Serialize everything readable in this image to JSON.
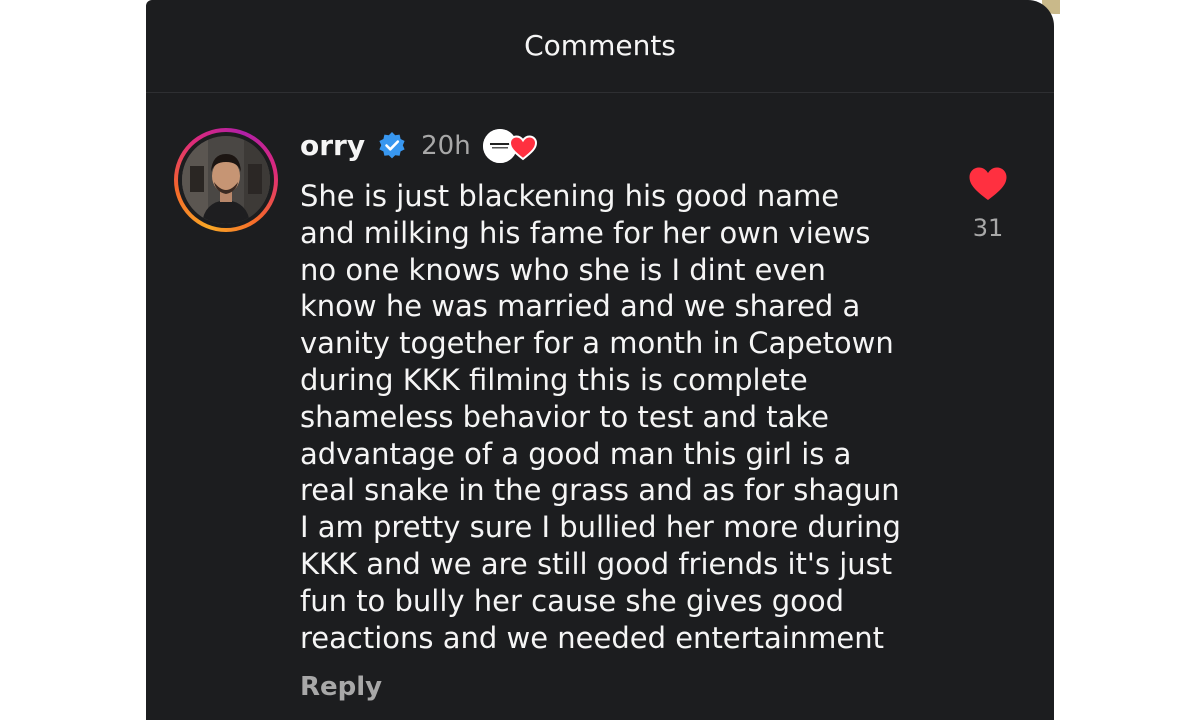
{
  "header": {
    "title": "Comments"
  },
  "comment": {
    "username": "orry",
    "verified": true,
    "verified_icon": "verified-badge-icon",
    "time": "20h",
    "creator_badge_icon": "creator-liked-heart-icon",
    "text_lines": [
      "She is just blackening his good name",
      "and milking his fame for her own views",
      "no one knows who she is I dint even",
      "know he was married and we shared a",
      "vanity together for a month in Capetown",
      "during KKK filming this is complete",
      "shameless behavior to test and take",
      "advantage of a good man this girl is a",
      "real snake in the grass and as for shagun",
      "I am pretty sure I bullied her more during",
      "KKK and we are still good friends it's just",
      "fun to bully her cause she gives good",
      "reactions and we needed entertainment"
    ],
    "like_icon": "heart-filled-icon",
    "like_count": "31",
    "reply_label": "Reply"
  },
  "colors": {
    "panel_background": "#1c1d1f",
    "text_primary": "#f5f5f5",
    "text_secondary": "#a8a8a8",
    "verified_blue": "#3897f0",
    "like_red": "#ff3040"
  }
}
